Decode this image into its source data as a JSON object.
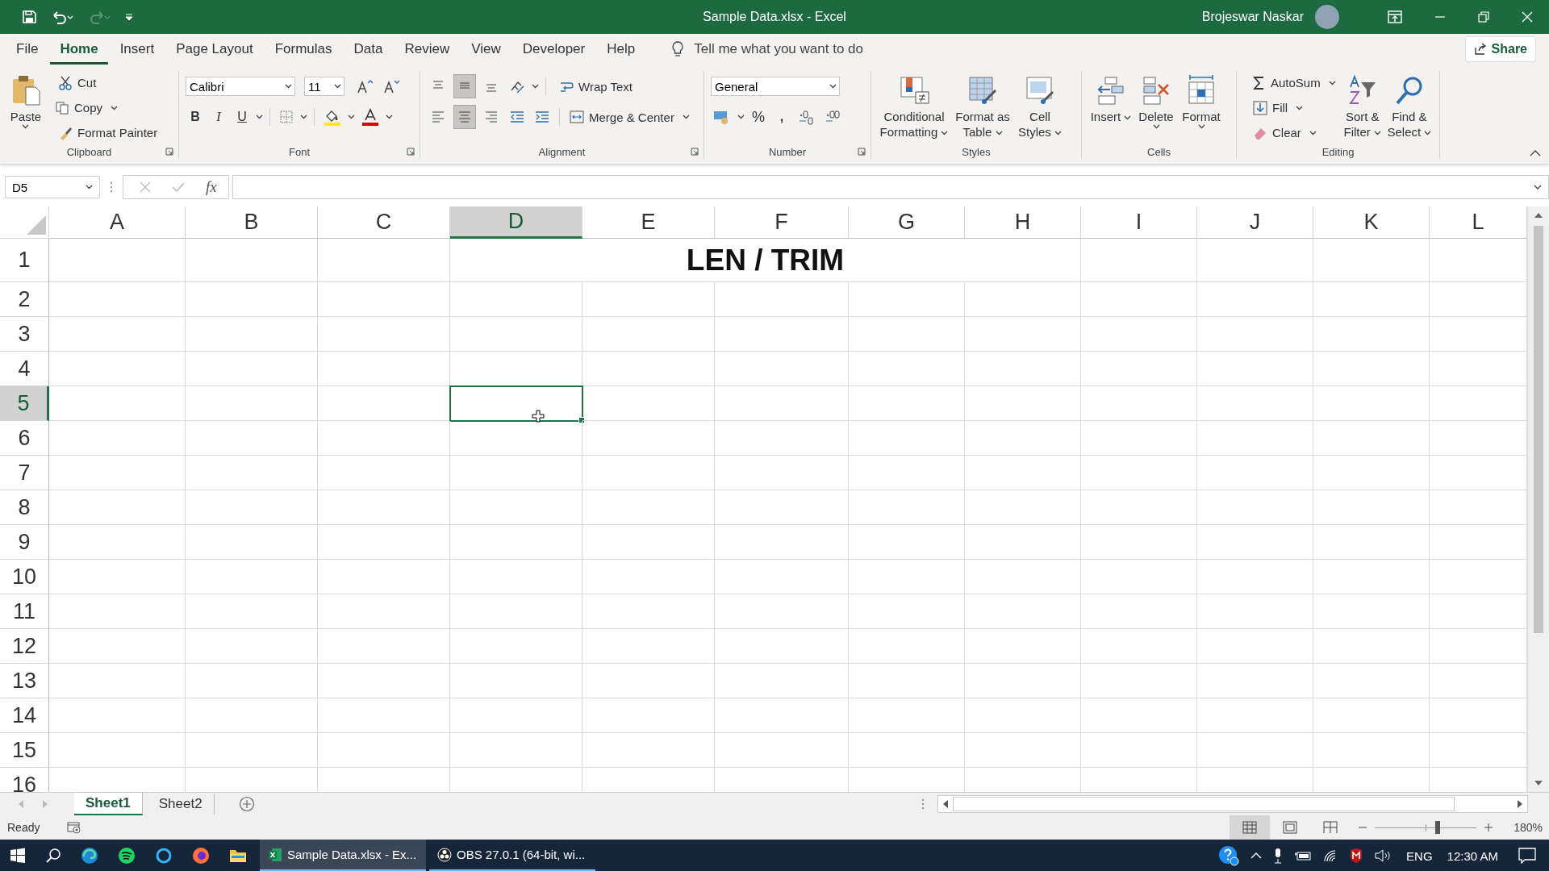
{
  "title_bar": {
    "title": "Sample Data.xlsx - Excel",
    "user": "Brojeswar Naskar",
    "redo": {
      "disabled": true
    }
  },
  "menu": {
    "tabs": [
      {
        "label": "File",
        "selected": false
      },
      {
        "label": "Home",
        "selected": true
      },
      {
        "label": "Insert",
        "selected": false
      },
      {
        "label": "Page Layout",
        "selected": false
      },
      {
        "label": "Formulas",
        "selected": false
      },
      {
        "label": "Data",
        "selected": false
      },
      {
        "label": "Review",
        "selected": false
      },
      {
        "label": "View",
        "selected": false
      },
      {
        "label": "Developer",
        "selected": false
      },
      {
        "label": "Help",
        "selected": false
      }
    ],
    "tell_me": "Tell me what you want to do",
    "share": "Share"
  },
  "ribbon": {
    "clipboard": {
      "label": "Clipboard",
      "paste": "Paste",
      "cut": "Cut",
      "copy": "Copy",
      "format_painter": "Format Painter"
    },
    "font": {
      "label": "Font",
      "font_name": "Calibri",
      "font_size": "11",
      "style_buttons": [
        {
          "label": "B",
          "kind": "bold"
        },
        {
          "label": "I",
          "kind": "italic"
        },
        {
          "label": "U",
          "kind": "underline"
        }
      ]
    },
    "alignment": {
      "label": "Alignment",
      "vertical": [
        {
          "selected": false
        },
        {
          "selected": true
        },
        {
          "selected": false
        }
      ],
      "horizontal": [
        {
          "selected": false
        },
        {
          "selected": true
        },
        {
          "selected": false
        }
      ],
      "wrap_text": "Wrap Text",
      "merge": "Merge & Center"
    },
    "number": {
      "label": "Number",
      "format": "General",
      "percent": "%",
      "comma": ","
    },
    "styles": {
      "label": "Styles",
      "buttons": [
        "Conditional Formatting",
        "Format as Table",
        "Cell Styles"
      ]
    },
    "cells": {
      "label": "Cells",
      "buttons": [
        "Insert",
        "Delete",
        "Format"
      ]
    },
    "editing": {
      "label": "Editing",
      "autosum": "AutoSum",
      "fill": "Fill",
      "clear": "Clear",
      "buttons": [
        "Sort & Filter",
        "Find & Select"
      ]
    }
  },
  "formula_bar": {
    "name_box": "D5",
    "fx": "fx"
  },
  "sheet": {
    "columns": [
      {
        "label": "A",
        "selected": false
      },
      {
        "label": "B",
        "selected": false
      },
      {
        "label": "C",
        "selected": false
      },
      {
        "label": "D",
        "selected": true
      },
      {
        "label": "E",
        "selected": false
      },
      {
        "label": "F",
        "selected": false
      },
      {
        "label": "G",
        "selected": false
      },
      {
        "label": "H",
        "selected": false
      },
      {
        "label": "I",
        "selected": false
      },
      {
        "label": "J",
        "selected": false
      },
      {
        "label": "K",
        "selected": false
      },
      {
        "label": "L",
        "selected": false
      }
    ],
    "rows": [
      {
        "label": "1",
        "selected": false
      },
      {
        "label": "2",
        "selected": false
      },
      {
        "label": "3",
        "selected": false
      },
      {
        "label": "4",
        "selected": false
      },
      {
        "label": "5",
        "selected": true
      },
      {
        "label": "6",
        "selected": false
      },
      {
        "label": "7",
        "selected": false
      },
      {
        "label": "8",
        "selected": false
      },
      {
        "label": "9",
        "selected": false
      },
      {
        "label": "10",
        "selected": false
      },
      {
        "label": "11",
        "selected": false
      },
      {
        "label": "12",
        "selected": false
      },
      {
        "label": "13",
        "selected": false
      },
      {
        "label": "14",
        "selected": false
      },
      {
        "label": "15",
        "selected": false
      },
      {
        "label": "16",
        "selected": false
      }
    ],
    "banner": "LEN / TRIM"
  },
  "sheet_tabs": [
    {
      "label": "Sheet1",
      "selected": true
    },
    {
      "label": "Sheet2",
      "selected": false
    }
  ],
  "status_bar": {
    "status": "Ready",
    "views": [
      {
        "selected": true
      },
      {
        "selected": false
      },
      {
        "selected": false
      }
    ],
    "zoom": {
      "level": 0.62,
      "reading": "180%"
    }
  },
  "taskbar": {
    "apps": [
      {
        "label": "Sample Data.xlsx - Ex...",
        "selected": true
      },
      {
        "label": "OBS 27.0.1 (64-bit, wi...",
        "selected": false
      }
    ],
    "language": "ENG",
    "clock": "12:30 AM"
  }
}
